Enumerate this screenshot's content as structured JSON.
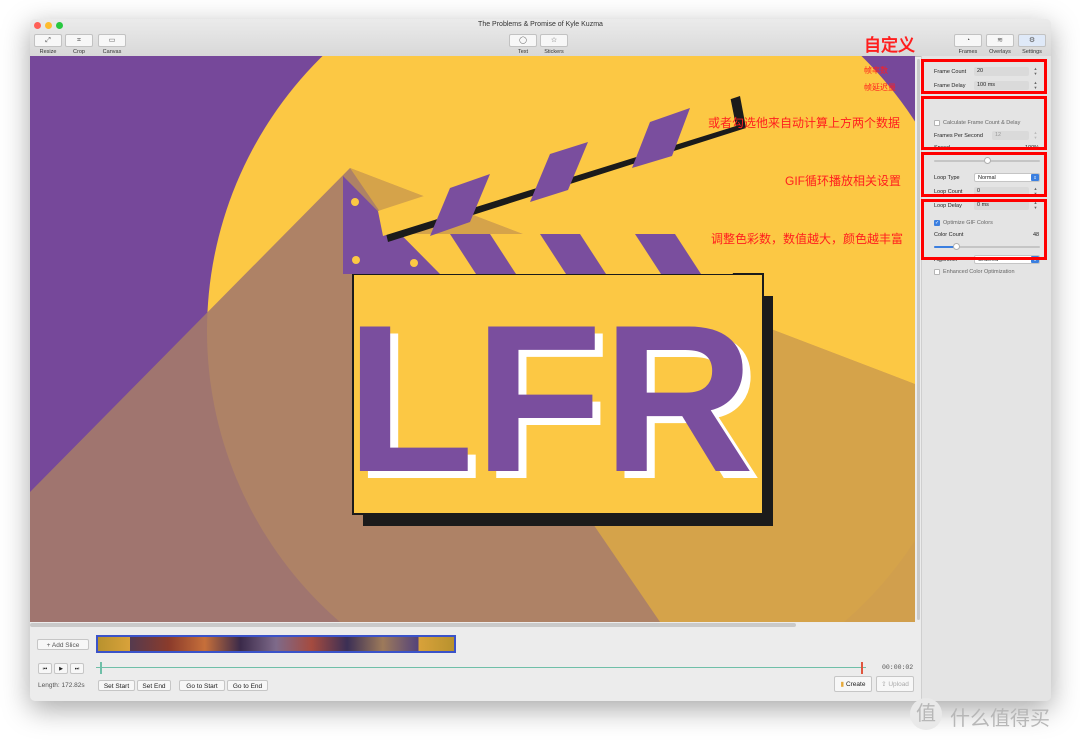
{
  "window": {
    "title": "The Problems & Promise of Kyle Kuzma"
  },
  "toolbar": {
    "left": [
      {
        "label": "Resize",
        "icon": "resize-icon"
      },
      {
        "label": "Crop",
        "icon": "crop-icon"
      },
      {
        "label": "Canvas",
        "icon": "canvas-icon"
      }
    ],
    "center": [
      {
        "label": "Text",
        "icon": "speech-bubble-icon"
      },
      {
        "label": "Stickers",
        "icon": "star-icon"
      }
    ],
    "right": [
      {
        "label": "Frames",
        "icon": "frames-icon"
      },
      {
        "label": "Overlays",
        "icon": "layers-icon"
      },
      {
        "label": "Settings",
        "icon": "gear-icon"
      }
    ]
  },
  "canvas": {
    "logo_text": "LFR",
    "colors": {
      "background": "#76489a",
      "circle": "#fcc844",
      "purple": "#7a4e9e",
      "shadow": "#1b1b1b"
    }
  },
  "settings": {
    "frame_count_label": "Frame Count",
    "frame_count_value": "20",
    "frame_delay_label": "Frame Delay",
    "frame_delay_value": "100 ms",
    "calc_label": "Calculate Frame Count & Delay",
    "fps_label": "Frames Per Second",
    "fps_value": "12",
    "speed_label": "Speed",
    "speed_value": "100%",
    "speed_fraction": 0.5,
    "loop_type_label": "Loop Type",
    "loop_type_value": "Normal",
    "loop_count_label": "Loop Count",
    "loop_count_value": "0",
    "loop_delay_label": "Loop Delay",
    "loop_delay_value": "0 ms",
    "optimize_label": "Optimize GIF Colors",
    "optimize_checked": true,
    "color_count_label": "Color Count",
    "color_count_value": "48",
    "color_count_fraction": 0.19,
    "algorithm_label": "Algorithm",
    "algorithm_value": "Ordered",
    "enhanced_label": "Enhanced Color Optimization"
  },
  "annotations": {
    "customize": "自定义",
    "frame_count": "帧率数",
    "frame_delay": "帧延迟量",
    "calc": "或者勾选他来自动计算上方两个数据",
    "loop": "GIF循环播放相关设置",
    "color": "调整色彩数，数值越大，颜色越丰富",
    "color_hex": "#ff1e1e"
  },
  "timeline": {
    "add_slice": "+ Add Slice",
    "time": "00:00:02",
    "length": "Length: 172.82s",
    "set_start": "Set Start",
    "set_end": "Set End",
    "go_start": "Go to Start",
    "go_end": "Go to End",
    "create": "Create",
    "upload": "Upload"
  },
  "watermark": {
    "text": "什么值得买",
    "logo_glyph": "值"
  }
}
